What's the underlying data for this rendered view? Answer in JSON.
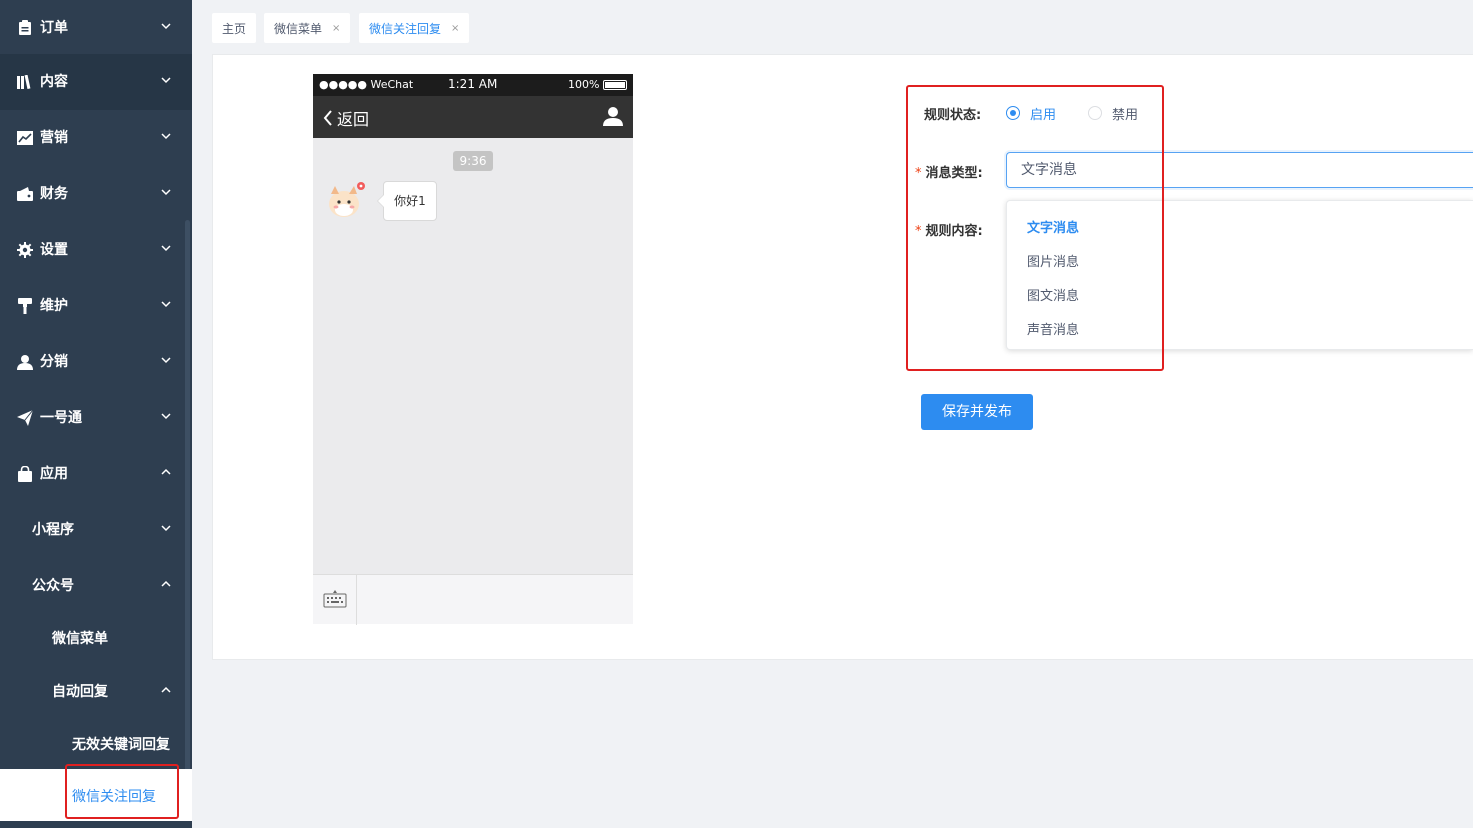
{
  "sidebar": {
    "items": [
      {
        "label": "订单",
        "icon": "clipboard-icon"
      },
      {
        "label": "内容",
        "icon": "books-icon"
      },
      {
        "label": "营销",
        "icon": "chart-icon"
      },
      {
        "label": "财务",
        "icon": "wallet-icon"
      },
      {
        "label": "设置",
        "icon": "gear-icon"
      },
      {
        "label": "维护",
        "icon": "paint-roller-icon"
      },
      {
        "label": "分销",
        "icon": "user-icon"
      },
      {
        "label": "一号通",
        "icon": "paper-plane-icon"
      },
      {
        "label": "应用",
        "icon": "shopping-bag-icon"
      }
    ],
    "sub": {
      "mini_program": "小程序",
      "official_account": "公众号",
      "wechat_menu": "微信菜单",
      "auto_reply": "自动回复",
      "invalid_keyword_reply": "无效关键词回复",
      "follow_reply": "微信关注回复"
    }
  },
  "tabs": [
    {
      "label": "主页",
      "closable": false
    },
    {
      "label": "微信菜单",
      "closable": true
    },
    {
      "label": "微信关注回复",
      "closable": true,
      "active": true
    }
  ],
  "phone": {
    "carrier": "●●●●● WeChat",
    "time": "1:21 AM",
    "battery": "100%",
    "back_label": "返回",
    "msg_time": "9:36",
    "message": "你好1"
  },
  "form": {
    "status_label": "规则状态:",
    "status_on": "启用",
    "status_off": "禁用",
    "type_label": "消息类型:",
    "type_value": "文字消息",
    "content_label": "规则内容:",
    "options": [
      "文字消息",
      "图片消息",
      "图文消息",
      "声音消息"
    ],
    "save_label": "保存并发布"
  },
  "colors": {
    "sidebar_bg": "#2e3e50",
    "primary": "#2d8cf0",
    "highlight_box": "#e02020"
  }
}
